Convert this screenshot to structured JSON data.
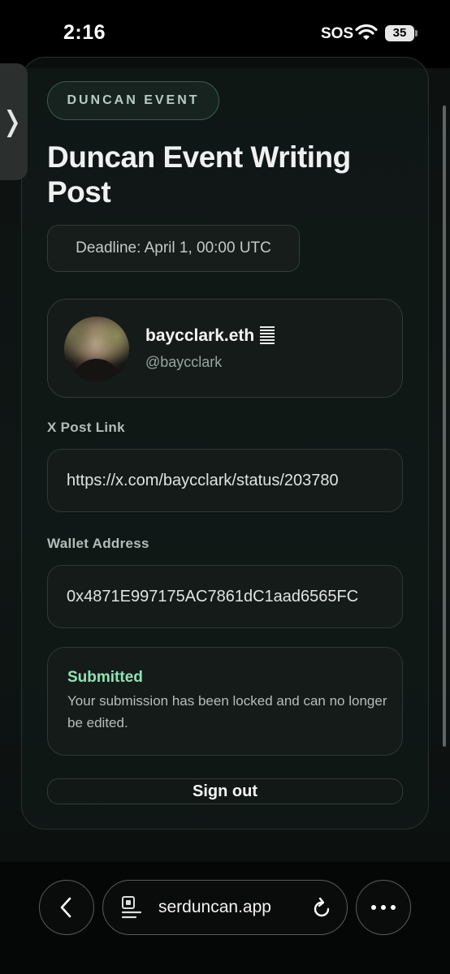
{
  "status_bar": {
    "time": "2:16",
    "sos": "SOS",
    "battery": "35"
  },
  "side_tab": {
    "glyph": "❭"
  },
  "event": {
    "badge": "DUNCAN EVENT",
    "title": "Duncan Event Writing Post",
    "deadline": "Deadline: April 1, 00:00 UTC"
  },
  "profile": {
    "name": "baycclark.eth",
    "handle": "@baycclark"
  },
  "form": {
    "x_post_label": "X Post Link",
    "x_post_value": "https://x.com/baycclark/status/203780",
    "wallet_label": "Wallet Address",
    "wallet_value": "0x4871E997175AC7861dC1aad6565FC"
  },
  "notice": {
    "title": "Submitted",
    "text": "Your submission has been locked and can no longer be edited."
  },
  "sign_out_label": "Sign out",
  "browser": {
    "url": "serduncan.app"
  },
  "colors": {
    "accent_green": "#8fe3b4",
    "background": "#0d1211"
  }
}
